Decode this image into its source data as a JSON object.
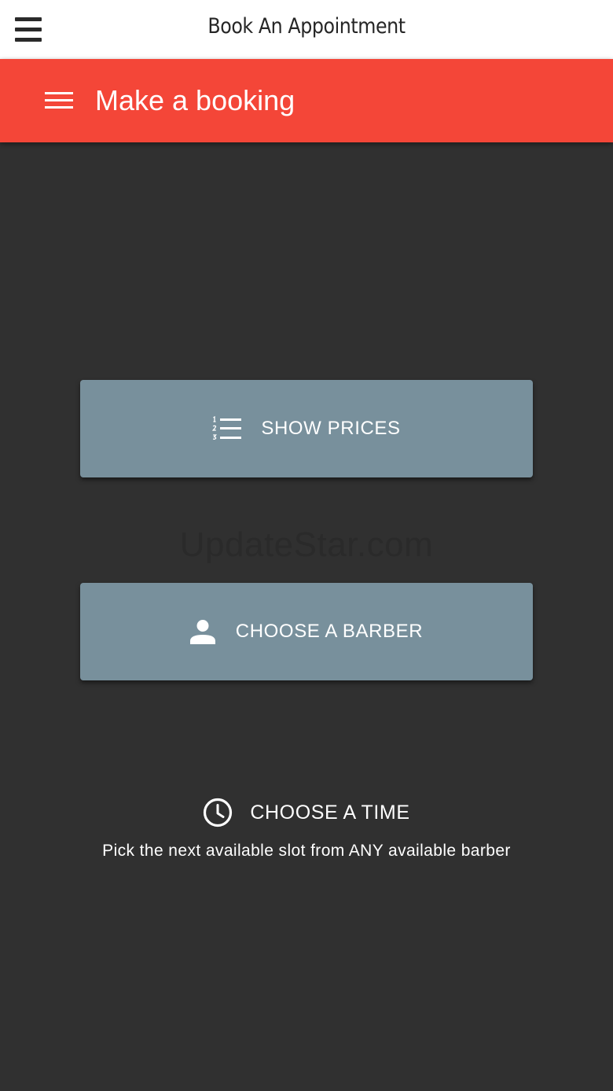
{
  "window": {
    "title": "Book An Appointment",
    "menu_icon": "menu-icon"
  },
  "appbar": {
    "title": "Make a booking",
    "menu_icon": "hamburger-icon",
    "color": "#f44638"
  },
  "actions": {
    "show_prices": {
      "label": "SHOW PRICES",
      "icon": "numbered-list-icon"
    },
    "choose_barber": {
      "label": "CHOOSE A BARBER",
      "icon": "person-icon"
    },
    "choose_time": {
      "label": "CHOOSE A TIME",
      "icon": "clock-icon",
      "hint": "Pick the next available slot from ANY available barber"
    }
  },
  "watermark": "UpdateStar.com",
  "colors": {
    "background": "#303030",
    "button": "#78909c",
    "accent": "#f44638"
  }
}
